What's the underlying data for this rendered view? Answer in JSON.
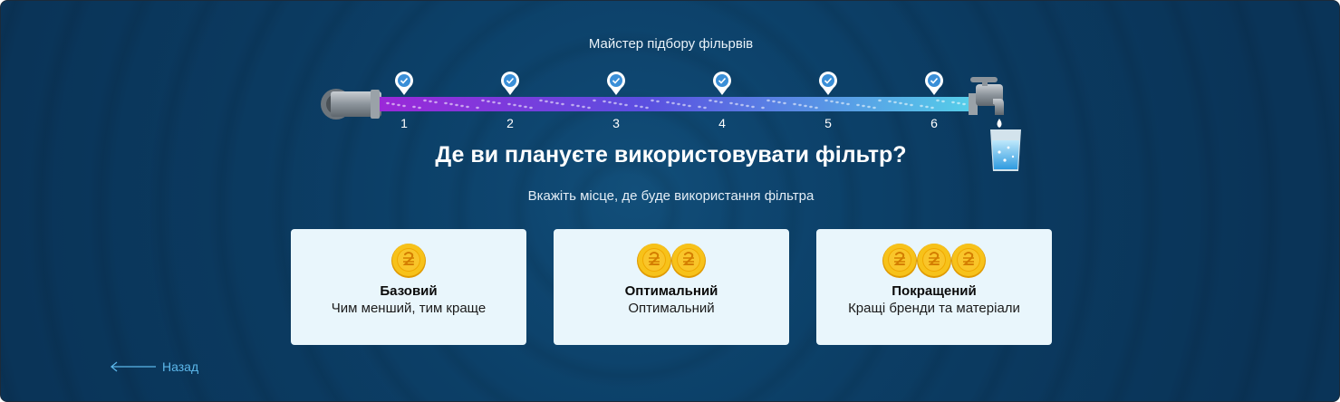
{
  "wizard": {
    "title": "Майстер підбору фільрвів",
    "steps": [
      "1",
      "2",
      "3",
      "4",
      "5",
      "6"
    ],
    "completed_steps": 6
  },
  "question": {
    "title": "Де ви плануєте використовувати фільтр?",
    "subtitle": "Вкажіть місце, де буде використання фільтра"
  },
  "options": [
    {
      "title": "Базовий",
      "description": "Чим менший, тим краще",
      "coins": 1,
      "coin_icon": "hryvnia-coin-icon"
    },
    {
      "title": "Оптимальний",
      "description": "Оптимальний",
      "coins": 2,
      "coin_icon": "hryvnia-coin-icon"
    },
    {
      "title": "Покращений",
      "description": "Кращі бренди та матеріали",
      "coins": 3,
      "coin_icon": "hryvnia-coin-icon"
    }
  ],
  "nav": {
    "back_label": "Назад"
  },
  "colors": {
    "background": "#0b3a60",
    "card_bg": "#e9f6fc",
    "check_blue": "#3a8fd8",
    "pipe_start": "#8a2be2",
    "pipe_end": "#52c7e8",
    "coin_gold": "#f4b400",
    "back_link": "#5cb7ea"
  }
}
